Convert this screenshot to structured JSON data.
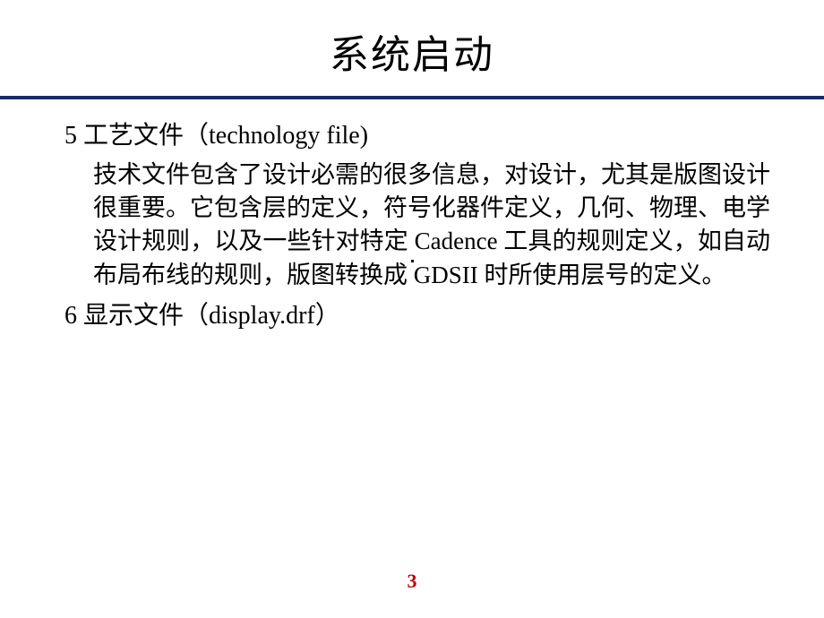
{
  "slide": {
    "title": "系统启动",
    "section5": {
      "heading": "5 工艺文件（technology file)",
      "body": "技术文件包含了设计必需的很多信息，对设计，尤其是版图设计很重要。它包含层的定义，符号化器件定义，几何、物理、电学设计规则，以及一些针对特定 Cadence 工具的规则定义，如自动布局布线的规则，版图转换成 GDSII 时所使用层号的定义。"
    },
    "section6": {
      "heading": "6 显示文件（display.drf）"
    },
    "pageNumber": "3"
  }
}
